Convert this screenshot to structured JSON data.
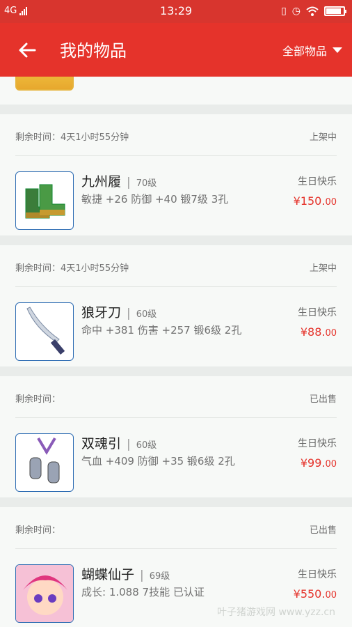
{
  "statusbar": {
    "network": "4G",
    "time": "13:29"
  },
  "header": {
    "title": "我的物品",
    "filter_label": "全部物品"
  },
  "items": [
    {
      "remain_label": "剩余时间：4天1小时55分钟",
      "status": "上架中",
      "name": "九州履",
      "level": "70级",
      "stats": "敏捷 +26 防御 +40  锻7级  3孔",
      "seller": "生日快乐",
      "price_main": "¥150.",
      "price_cents": "00",
      "icon": "boots-icon"
    },
    {
      "remain_label": "剩余时间：4天1小时55分钟",
      "status": "上架中",
      "name": "狼牙刀",
      "level": "60级",
      "stats": "命中 +381 伤害 +257  锻6级  2孔",
      "seller": "生日快乐",
      "price_main": "¥88.",
      "price_cents": "00",
      "icon": "blade-icon"
    },
    {
      "remain_label": "剩余时间：",
      "status": "已出售",
      "name": "双魂引",
      "level": "60级",
      "stats": "气血 +409 防御 +35  锻6级  2孔",
      "seller": "生日快乐",
      "price_main": "¥99.",
      "price_cents": "00",
      "icon": "pendant-icon"
    },
    {
      "remain_label": "剩余时间：",
      "status": "已出售",
      "name": "蝴蝶仙子",
      "level": "69级",
      "stats": "成长: 1.088  7技能  已认证",
      "seller": "生日快乐",
      "price_main": "¥550.",
      "price_cents": "00",
      "icon": "fairy-avatar-icon"
    }
  ],
  "watermark": "叶子猪游戏网 www.yzz.cn",
  "colors": {
    "appbar": "#e5332b",
    "price": "#e5332b",
    "background": "#e9ecea"
  }
}
